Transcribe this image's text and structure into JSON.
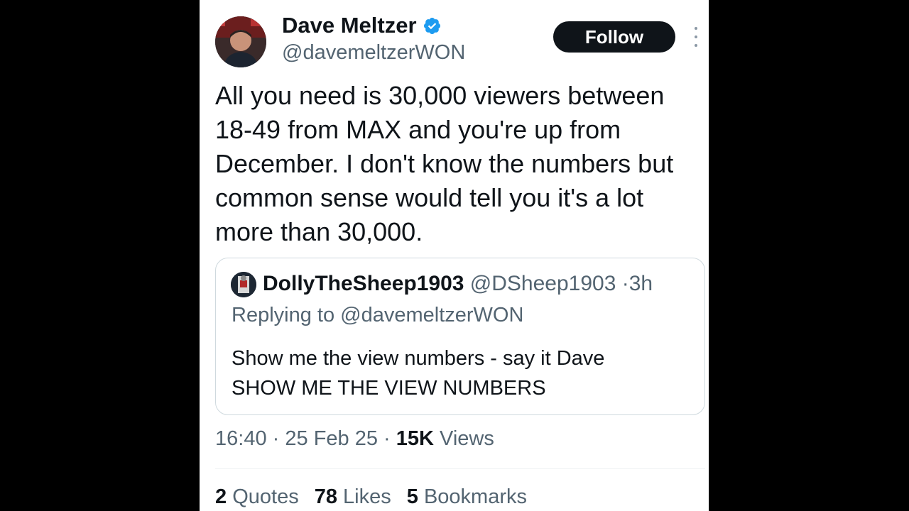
{
  "tweet": {
    "author": {
      "display_name": "Dave Meltzer",
      "handle": "@davemeltzerWON",
      "verified": true
    },
    "follow_label": "Follow",
    "text": "All you need is 30,000 viewers between 18-49 from MAX and you're up from December.  I don't know the numbers but common sense would tell you it's a lot more than 30,000.",
    "quote": {
      "display_name": "DollyTheSheep1903",
      "handle": "@DSheep1903",
      "separator": "·",
      "time": "3h",
      "replying_to": "Replying to @davemeltzerWON",
      "text_line1": "Show me the view numbers - say it Dave",
      "text_line2": "SHOW ME THE VIEW NUMBERS"
    },
    "meta": {
      "time": "16:40",
      "sep1": "·",
      "date": "25 Feb 25",
      "sep2": "·",
      "views_count": "15K",
      "views_label": "Views"
    },
    "stats": [
      {
        "count": "2",
        "label": "Quotes"
      },
      {
        "count": "78",
        "label": "Likes"
      },
      {
        "count": "5",
        "label": "Bookmarks"
      }
    ]
  },
  "colors": {
    "text_primary": "#0f1419",
    "text_secondary": "#536471",
    "verified_blue": "#1d9bf0",
    "follow_bg": "#0f1419",
    "background": "#000000"
  },
  "icons": {
    "verified": "verified-badge-icon",
    "more": "more-options-icon"
  }
}
